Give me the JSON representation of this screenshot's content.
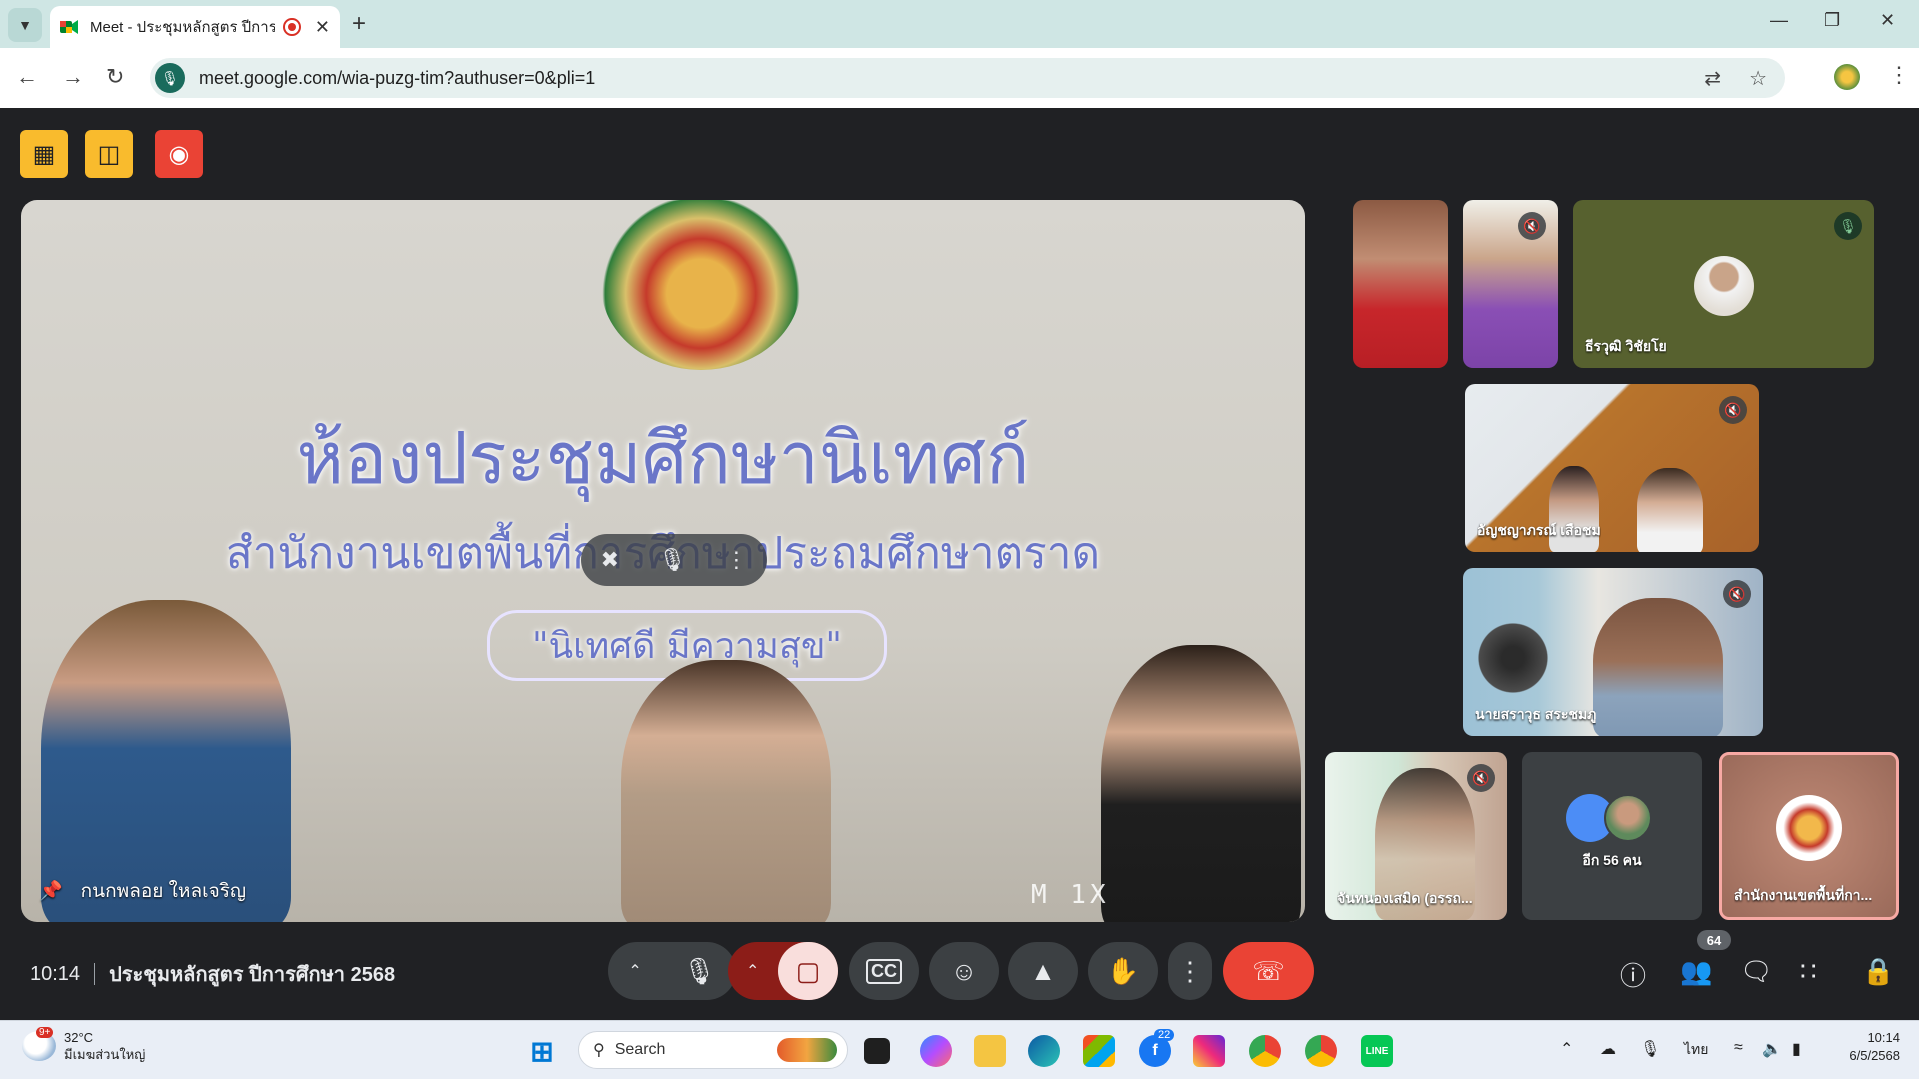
{
  "browser": {
    "tab_title": "Meet - ประชุมหลักสูตร ปีการศึ",
    "url": "meet.google.com/wia-puzg-tim?authuser=0&pli=1"
  },
  "main_video": {
    "pinned_name": "กนกพลอย ใหลเจริญ",
    "wall_line1": "ห้องประชุมศึกษานิเทศก์",
    "wall_line2": "สำนักงานเขตพื้นที่การศึกษาประถมศึกษาตราด",
    "wall_line3": "\"นิเทศดี มีความสุข\"",
    "overlay_text": "M 1X"
  },
  "tiles": [
    {
      "name": "ธีรวุฒิ วิชัยโย"
    },
    {
      "name": "อัญชญาภรณ์ เสือชม"
    },
    {
      "name": "นายสราวุธ สระชมภู"
    },
    {
      "name": "จันทนองเสมิด (อรรถ..."
    },
    {
      "name": "อีก 56 คน"
    },
    {
      "name": "สำนักงานเขตพื้นที่กา..."
    }
  ],
  "bottom_bar": {
    "time": "10:14",
    "meeting_title": "ประชุมหลักสูตร ปีการศึกษา 2568",
    "participant_count": "64"
  },
  "taskbar": {
    "weather_temp": "32°C",
    "weather_desc": "มีเมฆส่วนใหญ่",
    "weather_badge": "9+",
    "search_label": "Search",
    "badge_count": "22",
    "language": "ไทย",
    "clock_time": "10:14",
    "clock_date": "6/5/2568"
  },
  "colors": {
    "host_yellow": "#f9bb2d",
    "host_red": "#ea4335",
    "end_call": "#ea4335",
    "camera_off": "#8c1d18",
    "active_speaker_border": "#f7a9a4"
  }
}
